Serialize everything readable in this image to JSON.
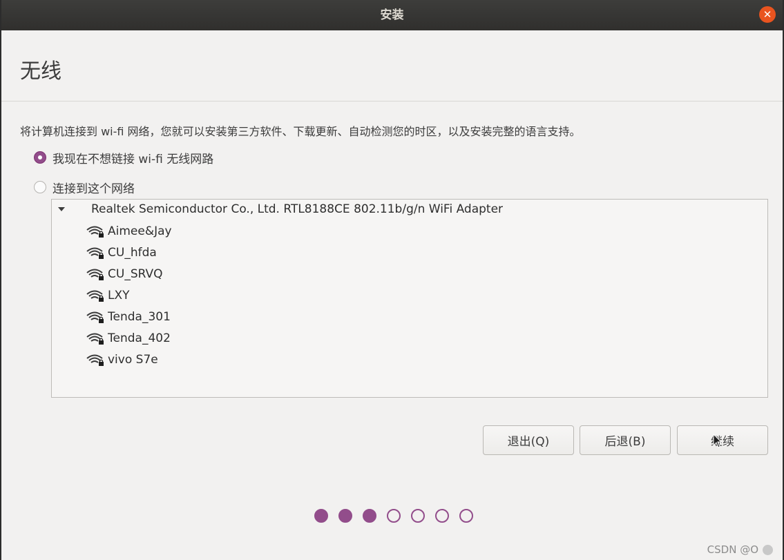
{
  "window": {
    "title": "安装"
  },
  "page": {
    "title": "无线",
    "description": "将计算机连接到 wi-fi 网络，您就可以安装第三方软件、下载更新、自动检测您的时区，以及安装完整的语言支持。"
  },
  "options": {
    "no_wifi": {
      "label": "我现在不想链接 wi-fi 无线网路",
      "selected": true
    },
    "connect": {
      "label": "连接到这个网络",
      "selected": false
    }
  },
  "network_list": {
    "adapter": "Realtek Semiconductor Co., Ltd. RTL8188CE 802.11b/g/n WiFi Adapter",
    "networks": [
      {
        "ssid": "Aimee&Jay",
        "icon": "wifi-locked-icon"
      },
      {
        "ssid": "CU_hfda",
        "icon": "wifi-locked-icon"
      },
      {
        "ssid": "CU_SRVQ",
        "icon": "wifi-locked-icon"
      },
      {
        "ssid": "LXY",
        "icon": "wifi-locked-icon"
      },
      {
        "ssid": "Tenda_301",
        "icon": "wifi-locked-icon"
      },
      {
        "ssid": "Tenda_402",
        "icon": "wifi-locked-icon"
      },
      {
        "ssid": "vivo S7e",
        "icon": "wifi-locked-icon"
      }
    ]
  },
  "buttons": {
    "quit": "退出(Q)",
    "back": "后退(B)",
    "continue": "继续"
  },
  "progress": {
    "total_steps": 7,
    "completed_steps": 3
  },
  "watermark": "CSDN @O",
  "colors": {
    "accent": "#924d8b",
    "close_button": "#e9541f",
    "titlebar": "#353432"
  }
}
